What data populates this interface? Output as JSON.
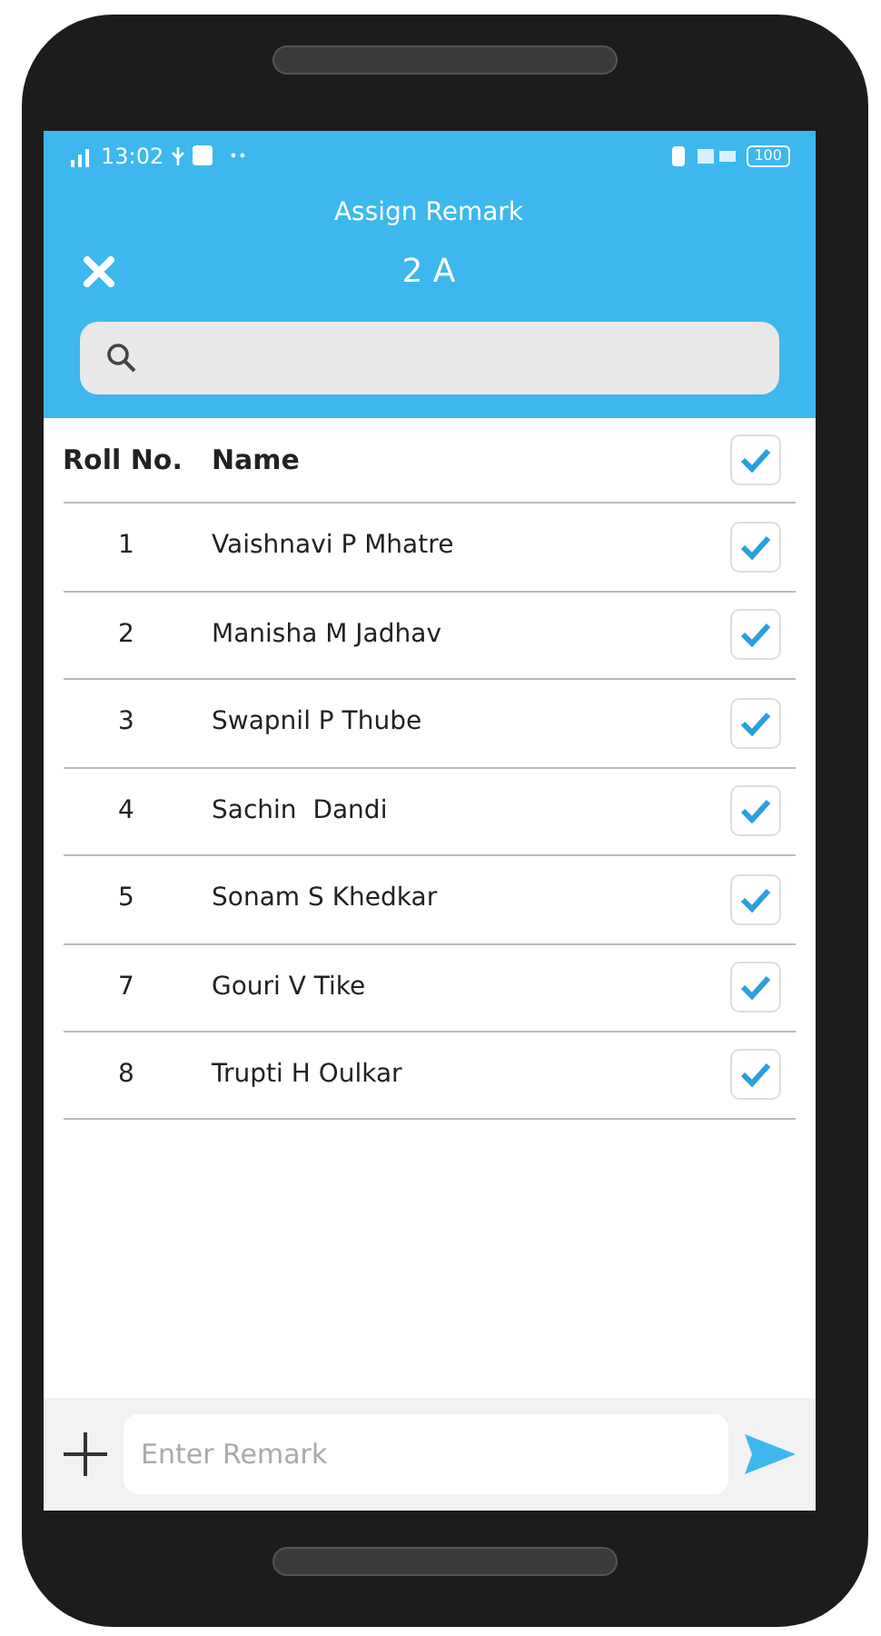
{
  "status_bar": {
    "time": "13:02",
    "battery": "100"
  },
  "header": {
    "title": "Assign Remark",
    "class_name": "2 A"
  },
  "table": {
    "columns": [
      "Roll No.",
      "Name"
    ],
    "select_all": {
      "checked": true
    },
    "rows": [
      {
        "roll": "1",
        "name": "Vaishnavi P Mhatre",
        "checked": true
      },
      {
        "roll": "2",
        "name": "Manisha M Jadhav",
        "checked": true
      },
      {
        "roll": "3",
        "name": "Swapnil P Thube",
        "checked": true
      },
      {
        "roll": "4",
        "name": "Sachin  Dandi",
        "checked": true
      },
      {
        "roll": "5",
        "name": "Sonam S Khedkar",
        "checked": true
      },
      {
        "roll": "7",
        "name": "Gouri V Tike",
        "checked": true
      },
      {
        "roll": "8",
        "name": "Trupti H Oulkar",
        "checked": true
      }
    ]
  },
  "remark": {
    "placeholder": "Enter Remark"
  }
}
